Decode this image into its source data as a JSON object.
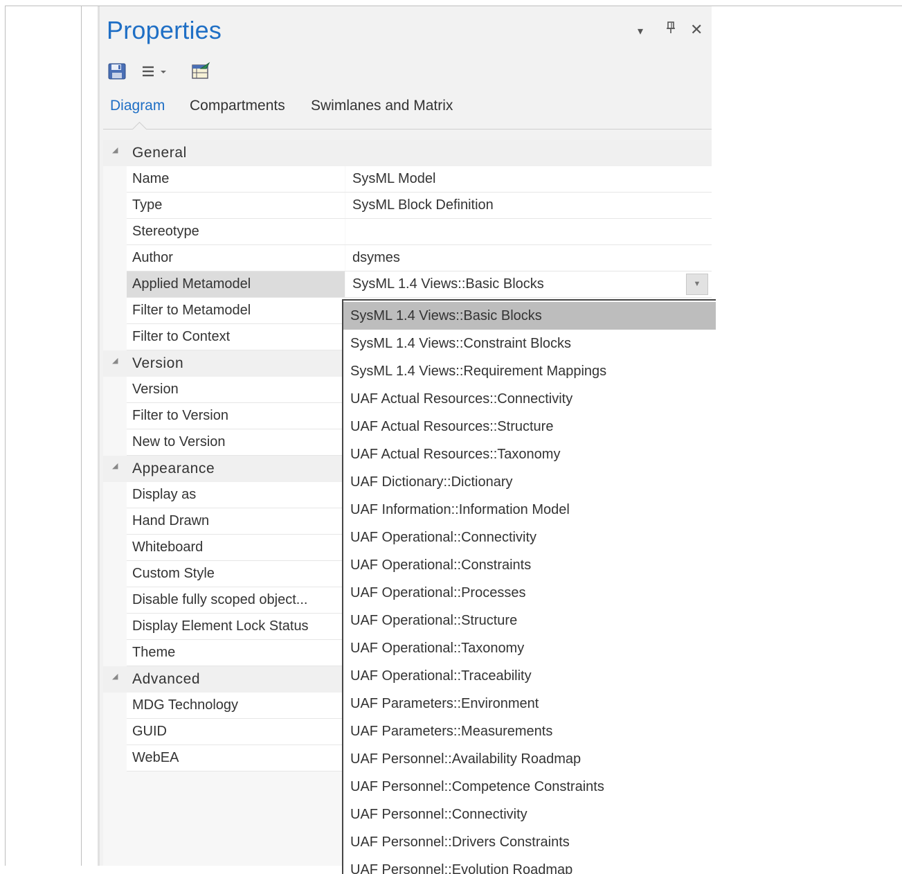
{
  "panel": {
    "title": "Properties",
    "controls": {
      "menu": "▾",
      "pin": "ȴ",
      "close": "✕"
    }
  },
  "toolbar": {
    "icons": [
      "save-icon",
      "menu-list-icon",
      "properties-icon"
    ]
  },
  "tabs": [
    {
      "label": "Diagram",
      "active": true
    },
    {
      "label": "Compartments",
      "active": false
    },
    {
      "label": "Swimlanes and Matrix",
      "active": false
    }
  ],
  "grid": {
    "general": {
      "label": "General",
      "rows": [
        {
          "name": "Name",
          "value": "SysML Model"
        },
        {
          "name": "Type",
          "value": "SysML Block Definition"
        },
        {
          "name": "Stereotype",
          "value": ""
        },
        {
          "name": "Author",
          "value": "dsymes"
        },
        {
          "name": "Applied Metamodel",
          "value": "SysML 1.4 Views::Basic Blocks"
        },
        {
          "name": "Filter to Metamodel",
          "value": ""
        },
        {
          "name": "Filter to Context",
          "value": ""
        }
      ]
    },
    "version": {
      "label": "Version",
      "rows": [
        {
          "name": "Version",
          "value": ""
        },
        {
          "name": "Filter to Version",
          "value": ""
        },
        {
          "name": "New to Version",
          "value": ""
        }
      ]
    },
    "appearance": {
      "label": "Appearance",
      "rows": [
        {
          "name": "Display as",
          "value": ""
        },
        {
          "name": "Hand Drawn",
          "value": ""
        },
        {
          "name": "Whiteboard",
          "value": ""
        },
        {
          "name": "Custom Style",
          "value": ""
        },
        {
          "name": "Disable fully scoped object...",
          "value": ""
        },
        {
          "name": "Display Element Lock Status",
          "value": ""
        },
        {
          "name": "Theme",
          "value": ""
        }
      ]
    },
    "advanced": {
      "label": "Advanced",
      "rows": [
        {
          "name": "MDG Technology",
          "value": ""
        },
        {
          "name": "GUID",
          "value": ""
        },
        {
          "name": "WebEA",
          "value": ""
        }
      ]
    }
  },
  "dropdown": {
    "selected": "SysML 1.4 Views::Basic Blocks",
    "options": [
      "SysML 1.4 Views::Basic Blocks",
      "SysML 1.4 Views::Constraint Blocks",
      "SysML 1.4 Views::Requirement Mappings",
      "UAF Actual Resources::Connectivity",
      "UAF Actual Resources::Structure",
      "UAF Actual Resources::Taxonomy",
      "UAF Dictionary::Dictionary",
      "UAF Information::Information Model",
      "UAF Operational::Connectivity",
      "UAF Operational::Constraints",
      "UAF Operational::Processes",
      "UAF Operational::Structure",
      "UAF Operational::Taxonomy",
      "UAF Operational::Traceability",
      "UAF Parameters::Environment",
      "UAF Parameters::Measurements",
      "UAF Personnel::Availability Roadmap",
      "UAF Personnel::Competence Constraints",
      "UAF Personnel::Connectivity",
      "UAF Personnel::Drivers Constraints",
      "UAF Personnel::Evolution Roadmap"
    ]
  }
}
